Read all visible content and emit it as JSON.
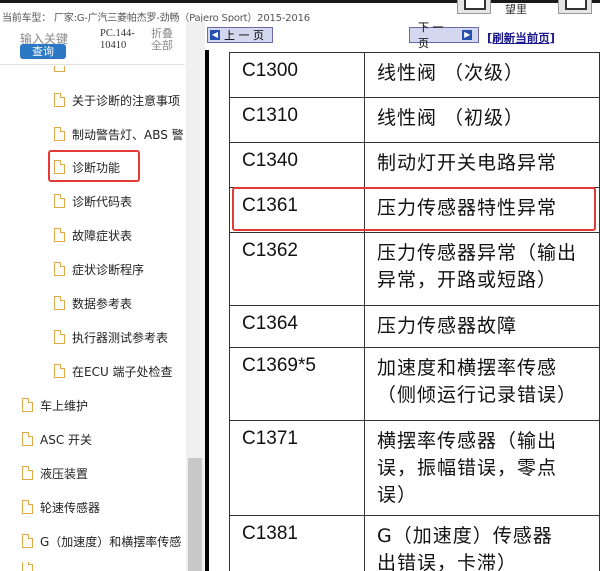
{
  "header": {
    "vehicle_text": "当前车型： 厂家:G-广汽三菱帕杰罗-劲畅（Pajero Sport）2015-2016",
    "right_label": "望里"
  },
  "search": {
    "keyword_label": "输入关键",
    "query_button": "查询",
    "pc_code_line1": "PC.144-",
    "pc_code_line2": "10410",
    "fold_line1": "折叠",
    "fold_line2": "全部"
  },
  "tree": {
    "items": [
      {
        "label": "关于诊断的注意事项"
      },
      {
        "label": "制动警告灯、ABS 警"
      },
      {
        "label": "诊断功能"
      },
      {
        "label": "诊断代码表"
      },
      {
        "label": "故障症状表"
      },
      {
        "label": "症状诊断程序"
      },
      {
        "label": "数据参考表"
      },
      {
        "label": "执行器测试参考表"
      },
      {
        "label": "在ECU 端子处检查"
      },
      {
        "label": "车上维护"
      },
      {
        "label": "ASC 开关"
      },
      {
        "label": "液压装置"
      },
      {
        "label": "轮速传感器"
      },
      {
        "label": "G（加速度）和横摆率传感"
      }
    ]
  },
  "nav": {
    "prev": "上 一 页",
    "next": "下 一 页",
    "refresh": "[刷新当前页]"
  },
  "codes_table": {
    "rows": [
      {
        "code": "C1300",
        "desc": "线性阀 （次级）"
      },
      {
        "code": "C1310",
        "desc": "线性阀 （初级）"
      },
      {
        "code": "C1340",
        "desc": "制动灯开关电路异常"
      },
      {
        "code": "C1361",
        "desc": "压力传感器特性异常"
      },
      {
        "code": "C1362",
        "desc": "压力传感器异常（输出",
        "desc2": "异常，开路或短路）"
      },
      {
        "code": "C1364",
        "desc": "压力传感器故障"
      },
      {
        "code": "C1369*5",
        "desc": "加速度和横摆率传感",
        "desc2": "（侧倾运行记录错误）"
      },
      {
        "code": "C1371",
        "desc": "横摆率传感器（输出",
        "desc2": "误，振幅错误，零点",
        "desc3": "误）"
      },
      {
        "code": "C1381",
        "desc": "G（加速度）传感器",
        "desc2": "出错误，卡滞）"
      }
    ]
  },
  "colors": {
    "highlight": "#e53935",
    "query_button": "#2b78c4",
    "nav_button": "#d4d8ee"
  },
  "icons": {
    "tree_item": "document-icon",
    "nav_prev": "arrow-left-icon",
    "nav_next": "arrow-right-icon"
  }
}
